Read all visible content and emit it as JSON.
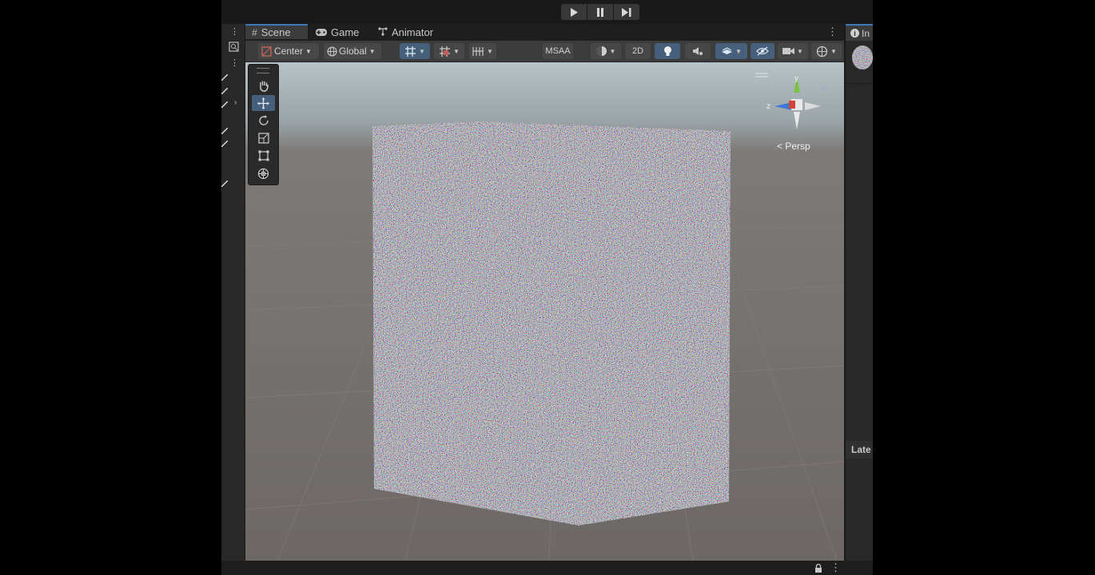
{
  "playbar": {
    "play": "play-icon",
    "pause": "pause-icon",
    "step": "step-icon"
  },
  "tabs": [
    {
      "label": "Scene",
      "icon": "grid-icon"
    },
    {
      "label": "Game",
      "icon": "gamepad-icon"
    },
    {
      "label": "Animator",
      "icon": "animator-icon"
    }
  ],
  "toolbar": {
    "pivot_label": "Center",
    "space_label": "Global",
    "msaa_label": "MSAA",
    "mode_2d_label": "2D"
  },
  "viewport": {
    "projection_label": "Persp",
    "gizmo_y": "y",
    "gizmo_z": "z"
  },
  "tools": [
    "hand-tool",
    "move-tool",
    "rotate-tool",
    "scale-tool",
    "rect-tool",
    "transform-tool"
  ],
  "inspector": {
    "tab_label": "In",
    "section_label": "Late"
  },
  "colors": {
    "accent": "#3a79bb",
    "toolbar_active": "#46607c",
    "panel": "#282828",
    "toolbar": "#3c3c3c"
  }
}
